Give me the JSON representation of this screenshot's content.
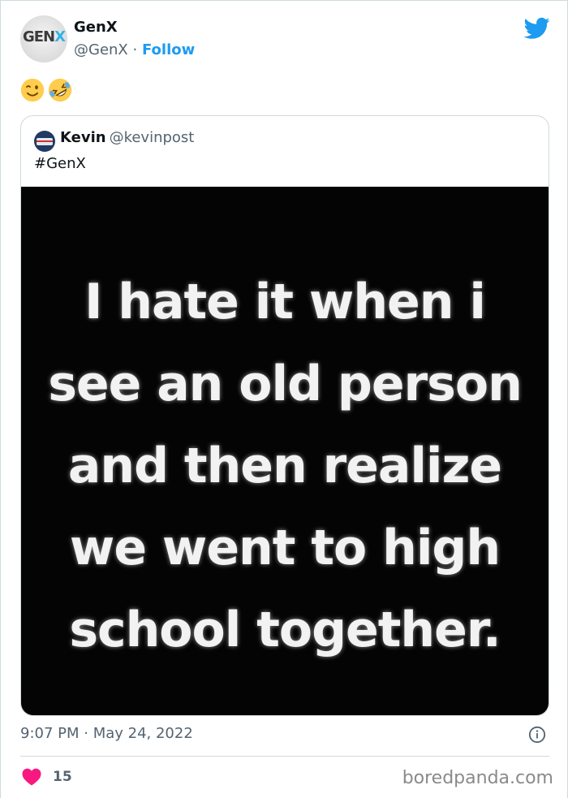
{
  "author": {
    "name": "GenX",
    "handle": "@GenX",
    "separator": "·",
    "follow_label": "Follow",
    "avatar_text_main": "GEN",
    "avatar_text_accent": "X"
  },
  "tweet": {
    "emojis": [
      "winking-face",
      "rolling-on-the-floor-laughing"
    ]
  },
  "quoted": {
    "name": "Kevin",
    "handle": "@kevinpost",
    "text": "#GenX",
    "image_text_lines": [
      "I hate it when i",
      "see an old person",
      "and then realize",
      "we went to high",
      "school together."
    ]
  },
  "footer": {
    "timestamp": "9:07 PM · May 24, 2022",
    "like_count": "15"
  },
  "watermark": "boredpanda.com",
  "colors": {
    "twitter_blue": "#1d9bf0",
    "like_red": "#f91880",
    "text_secondary": "#536471",
    "border": "#cfd9de"
  }
}
